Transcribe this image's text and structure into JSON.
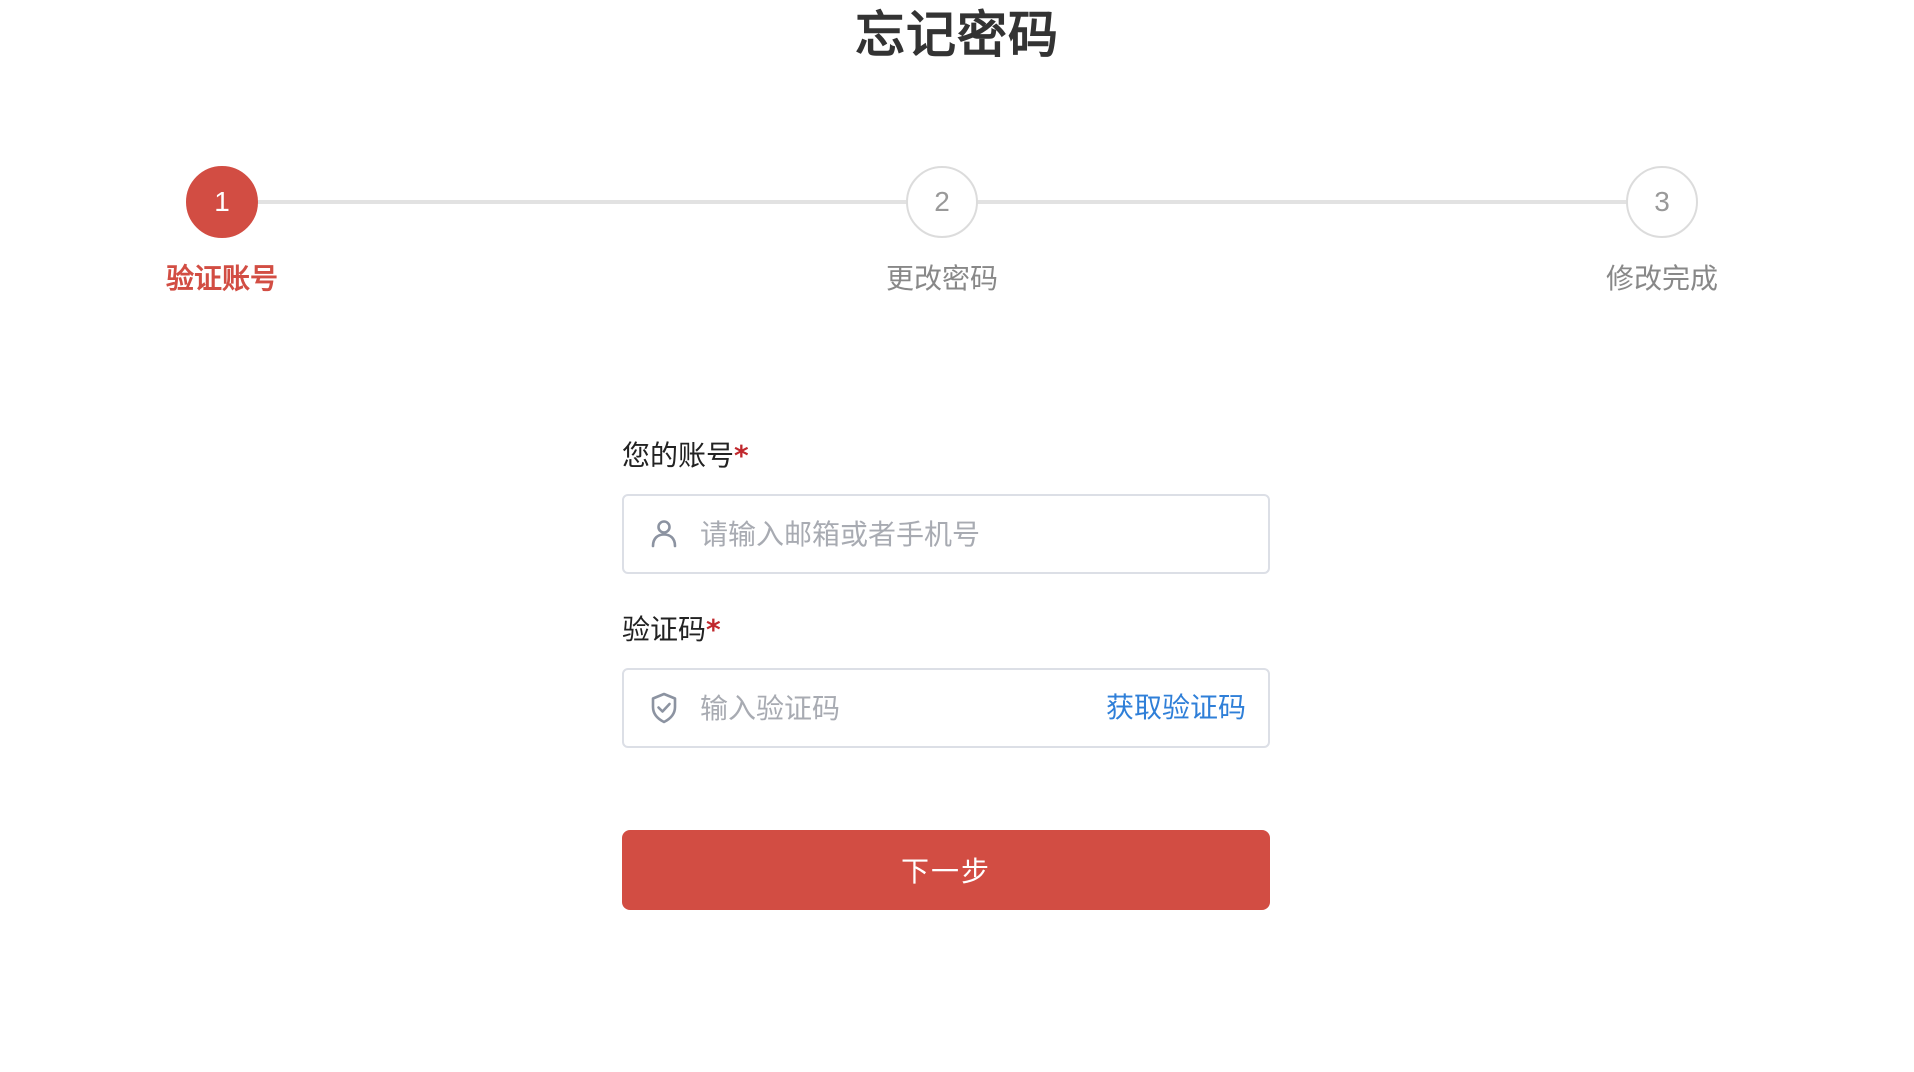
{
  "page": {
    "title": "忘记密码"
  },
  "steps": [
    {
      "number": "1",
      "label": "验证账号",
      "state": "active"
    },
    {
      "number": "2",
      "label": "更改密码",
      "state": "pending"
    },
    {
      "number": "3",
      "label": "修改完成",
      "state": "pending"
    }
  ],
  "form": {
    "account": {
      "label": "您的账号",
      "required_mark": "*",
      "value": "",
      "placeholder": "请输入邮箱或者手机号",
      "icon": "user-icon"
    },
    "code": {
      "label": "验证码",
      "required_mark": "*",
      "value": "",
      "placeholder": "输入验证码",
      "icon": "shield-check-icon",
      "get_code_label": "获取验证码"
    },
    "next_label": "下一步"
  },
  "colors": {
    "accent": "#d24d43",
    "link": "#2f7fd8",
    "required": "#c0282d",
    "inactive": "#999999"
  }
}
